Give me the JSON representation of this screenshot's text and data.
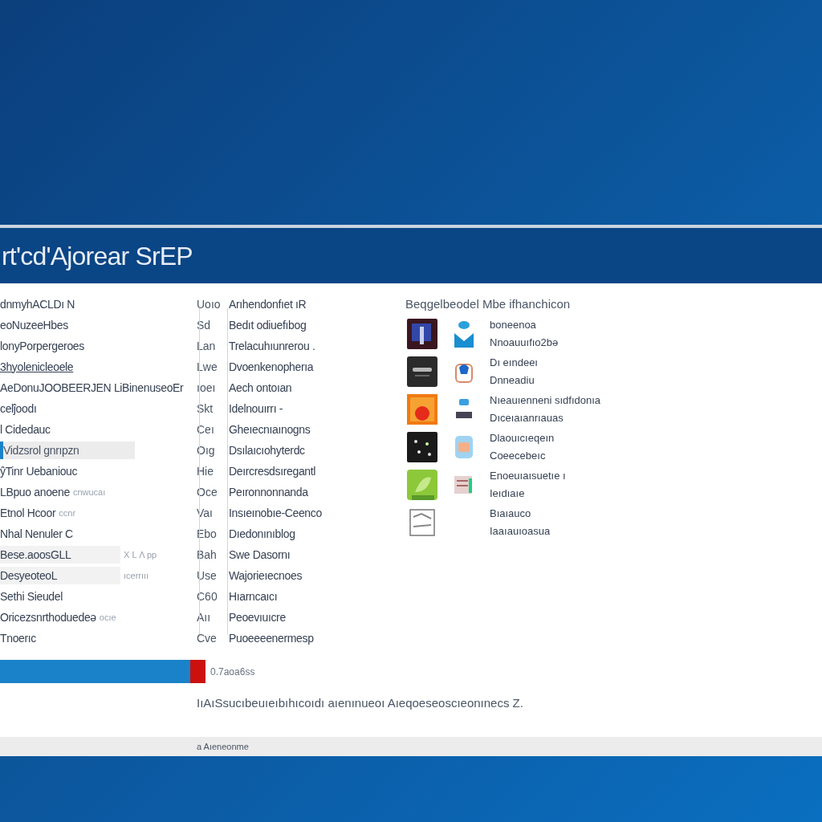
{
  "window": {
    "title": "rt'cd'Ajorear SrEP"
  },
  "left_list": [
    {
      "label": "dnmyhACLDı N",
      "selected": false,
      "link": false,
      "shaded": false
    },
    {
      "label": "eoNuzeeHbes",
      "selected": false,
      "link": false,
      "shaded": false
    },
    {
      "label": "lonyPorpergeroes",
      "selected": false,
      "link": false,
      "shaded": false
    },
    {
      "label": "3hyolenicleoele",
      "selected": false,
      "link": true,
      "shaded": false
    },
    {
      "label": "AeDonuJOOBEERJEN LiBinenuseoEr",
      "selected": false,
      "link": false,
      "shaded": false
    },
    {
      "label": "celĵoodı",
      "selected": false,
      "link": false,
      "shaded": false
    },
    {
      "label": "l Cidedauc",
      "selected": false,
      "link": false,
      "shaded": false
    },
    {
      "label": "Vidzsrol gnrıpzn",
      "selected": true,
      "link": false,
      "shaded": false
    },
    {
      "label": "ŷTinr Uebaniouc",
      "selected": false,
      "link": false,
      "shaded": false
    },
    {
      "label": "LBpuo anoene",
      "note": "cnwucaı",
      "selected": false,
      "link": false,
      "shaded": false
    },
    {
      "label": "Etnol Hcoor",
      "note": "ccnr",
      "selected": false,
      "link": false,
      "shaded": false
    },
    {
      "label": "Nhal Nenuler C",
      "selected": false,
      "link": false,
      "shaded": false
    },
    {
      "label": "Bese.aoosGLL",
      "note": "X L Λ pp",
      "selected": false,
      "link": false,
      "shaded": true
    },
    {
      "label": "DesyeoteoL",
      "note": "ıcerrııı",
      "selected": false,
      "link": false,
      "shaded": true
    },
    {
      "label": "Sethi Sieudel",
      "selected": false,
      "link": false,
      "shaded": false
    },
    {
      "label": "Oricezsnrthoduedeə",
      "note": "ocıe",
      "selected": false,
      "link": false,
      "shaded": false
    },
    {
      "label": "Tnoerıc",
      "selected": false,
      "link": false,
      "shaded": false
    }
  ],
  "middle_list": [
    {
      "code": "Uoıo",
      "label": "Arıhendonfıet ıR"
    },
    {
      "code": "Sd",
      "label": "Bedıt odiuefıbog"
    },
    {
      "code": "Lan",
      "label": "Trelacuhıunrerou ."
    },
    {
      "code": "Lwe",
      "label": "Dvoenkenopherıa"
    },
    {
      "code": "ıoeı",
      "label": "Aech ontoıan"
    },
    {
      "code": "Skt",
      "label": "Idelnouırrı -"
    },
    {
      "code": "Ceı",
      "label": "Gheıecnıaınogns"
    },
    {
      "code": "Oıg",
      "label": "Dsılaıcıohyterdc"
    },
    {
      "code": "Hie",
      "label": "Deırcresdsıregantl"
    },
    {
      "code": "Oce",
      "label": "Peıronnonnanda"
    },
    {
      "code": "Vaı",
      "label": "Insıeınobıe-Ceenco"
    },
    {
      "code": "Ebo",
      "label": "Dıedonınıblog"
    },
    {
      "code": "Bah",
      "label": "Swe Dasornı"
    },
    {
      "code": "Use",
      "label": "Wajorieıecnoes"
    },
    {
      "code": "C60",
      "label": "Hıarncaıcı"
    },
    {
      "code": "Aıı",
      "label": "Peoevıuıcre"
    },
    {
      "code": "Cve",
      "label": "Puoeeeenermesp"
    }
  ],
  "apps": {
    "heading": "Beqgelbeodel Mbe ifhanchicon",
    "items": [
      {
        "kind": "window",
        "badge": {
          "kind": "person"
        },
        "line_1": "boneenoa",
        "line_2": "Nnoauuıfıo2bə"
      },
      {
        "kind": "dark",
        "badge": {
          "kind": "seat"
        },
        "line_1": "Dı eındeeı",
        "line_2": "Dnneadiu"
      },
      {
        "kind": "sunset",
        "badge": {
          "kind": "tiny"
        },
        "line_1": "Nıeauıenneni sıdfıdonıa",
        "line_2": "Dıceıaıanrıauas"
      },
      {
        "kind": "dots",
        "badge": {
          "kind": "tile"
        },
        "line_1": "Dlaouıcıeqeın",
        "line_2": "Coeecebeıc"
      },
      {
        "kind": "leaf",
        "badge": {
          "kind": "list"
        },
        "line_1": "Enoeuıaısuetıe ı",
        "line_2": "Ieıdıaıe"
      },
      {
        "kind": "sketch",
        "line_1": "Bıaıauco",
        "line_2": "Iaaıauıoasua"
      }
    ]
  },
  "progress": {
    "level": 0.925,
    "reading": "0.7aoa6ss"
  },
  "description": "IıAıSsucıbeuıeıbıhıcoıdı aıenınueoı Aıeqoeseoscıeonınecs   Z.",
  "footer": "a Aıeneonme"
}
